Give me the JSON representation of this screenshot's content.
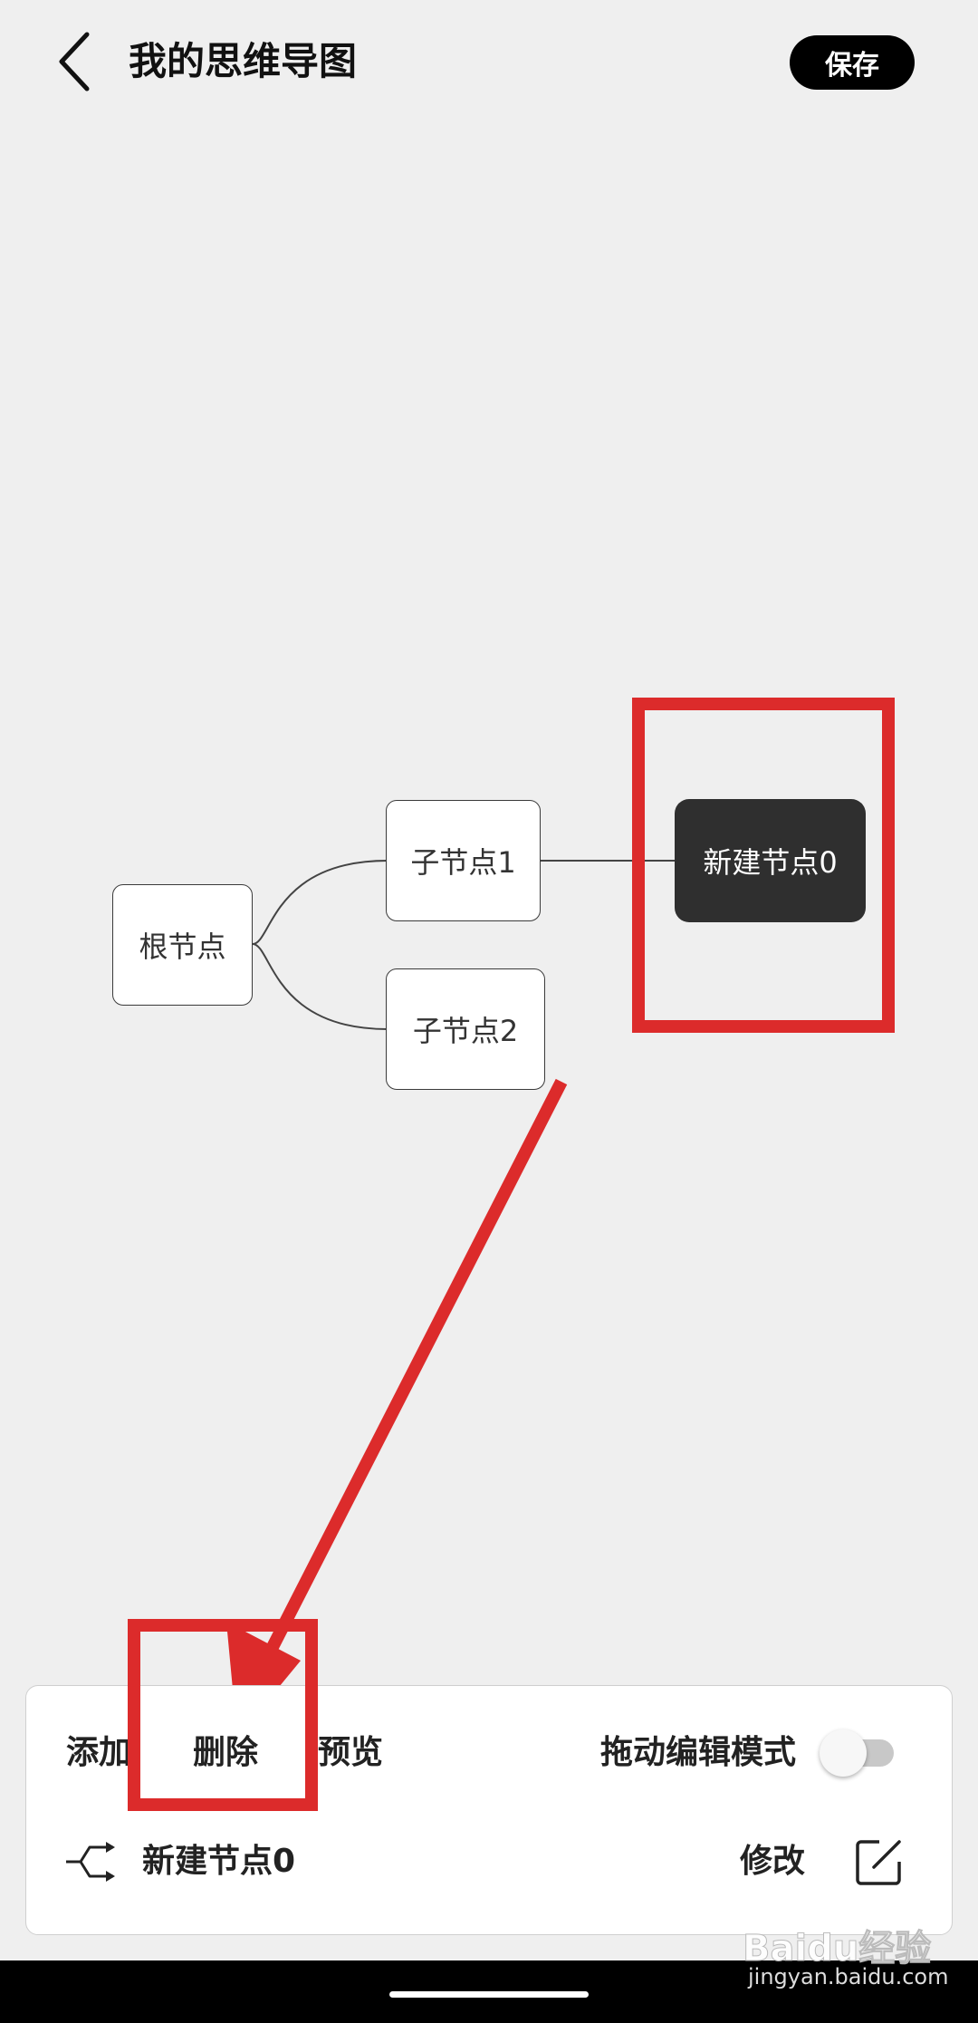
{
  "header": {
    "title": "我的思维导图",
    "save_label": "保存"
  },
  "mindmap": {
    "root": "根节点",
    "child1": "子节点1",
    "child2": "子节点2",
    "new_node": "新建节点0"
  },
  "panel": {
    "add_label": "添加",
    "delete_label": "删除",
    "preview_label": "预览",
    "drag_mode_label": "拖动编辑模式",
    "drag_mode_on": false,
    "selected_node_name": "新建节点0",
    "edit_label": "修改"
  },
  "watermark": {
    "logo": "Baidu经验",
    "url": "jingyan.baidu.com"
  },
  "colors": {
    "annotation": "#dc2b2b",
    "selected_node": "#2f2f2f",
    "background": "#efefef"
  }
}
